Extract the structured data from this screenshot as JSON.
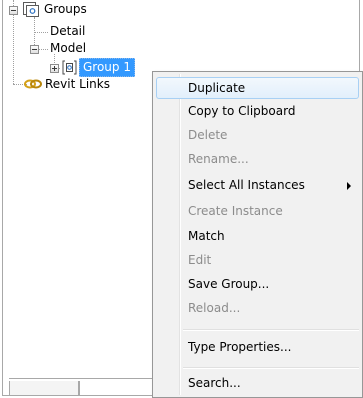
{
  "tree": {
    "groups_label": "Groups",
    "detail_label": "Detail",
    "model_label": "Model",
    "group1_label": "Group 1",
    "revit_links_label": "Revit Links"
  },
  "context_menu": {
    "items": [
      {
        "label": "Duplicate",
        "enabled": true,
        "highlighted": true
      },
      {
        "label": "Copy to Clipboard",
        "enabled": true
      },
      {
        "label": "Delete",
        "enabled": false
      },
      {
        "label": "Rename...",
        "enabled": false
      },
      {
        "label": "Select All Instances",
        "enabled": true,
        "submenu": true
      },
      {
        "label": "Create Instance",
        "enabled": false
      },
      {
        "label": "Match",
        "enabled": true
      },
      {
        "label": "Edit",
        "enabled": false
      },
      {
        "label": "Save Group...",
        "enabled": true
      },
      {
        "label": "Reload...",
        "enabled": false
      },
      {
        "label": "Type Properties...",
        "enabled": true
      },
      {
        "label": "Search...",
        "enabled": true
      }
    ]
  },
  "colors": {
    "selection": "#3399ff",
    "links_icon": "#d4a017",
    "disabled_text": "#8c8c8c"
  }
}
